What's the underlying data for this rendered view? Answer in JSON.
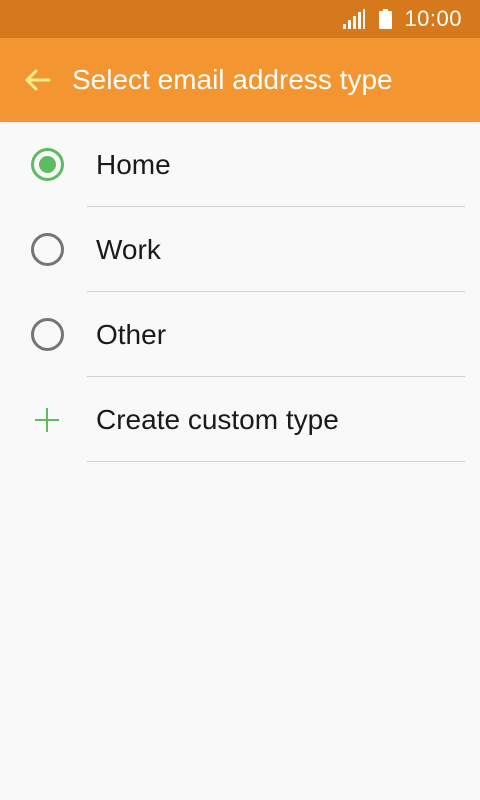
{
  "status_bar": {
    "time": "10:00",
    "signal_icon": "signal-icon",
    "battery_icon": "battery-icon"
  },
  "header": {
    "back_icon": "arrow-left-icon",
    "title": "Select email address type"
  },
  "options": [
    {
      "label": "Home",
      "selected": true
    },
    {
      "label": "Work",
      "selected": false
    },
    {
      "label": "Other",
      "selected": false
    }
  ],
  "custom": {
    "icon": "plus-icon",
    "label": "Create custom type"
  },
  "colors": {
    "status_bar": "#d5791c",
    "title_bar": "#f39631",
    "back_arrow": "#ffef8a",
    "accent": "#5dbb63",
    "radio_off": "#757575",
    "background": "#f9f9f9",
    "divider": "#d2d2d2"
  }
}
